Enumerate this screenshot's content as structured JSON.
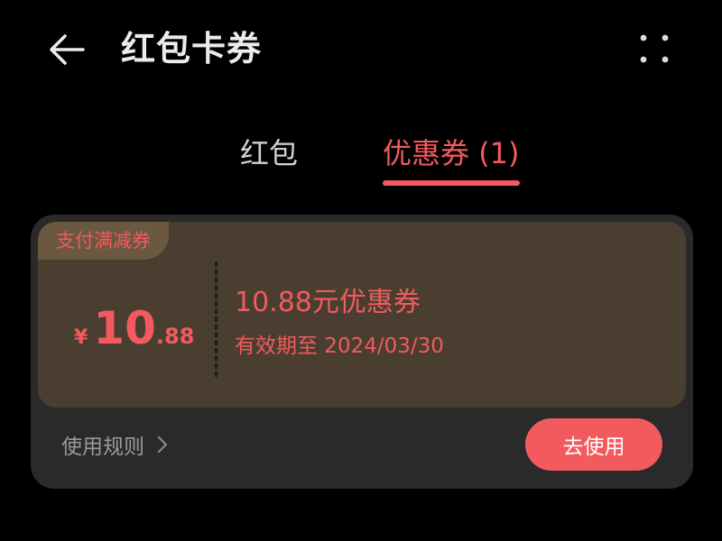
{
  "header": {
    "title": "红包卡券",
    "back_icon": "arrow-left-icon",
    "more_icon": "more-dots-icon"
  },
  "tabs": [
    {
      "label": "红包",
      "active": false
    },
    {
      "label": "优惠券 (1)",
      "active": true
    }
  ],
  "coupon": {
    "tag": "支付满减券",
    "currency_symbol": "¥",
    "amount_integer": "10",
    "amount_decimal": ".88",
    "name": "10.88元优惠券",
    "validity": "有效期至 2024/03/30",
    "rules_label": "使用规则",
    "rules_icon": "chevron-right-icon",
    "use_button_label": "去使用"
  },
  "colors": {
    "background": "#000000",
    "accent": "#f25a5e",
    "card": "#2a2a2a",
    "card_body": "#4a3e30",
    "tag_bg": "#6a5840"
  }
}
